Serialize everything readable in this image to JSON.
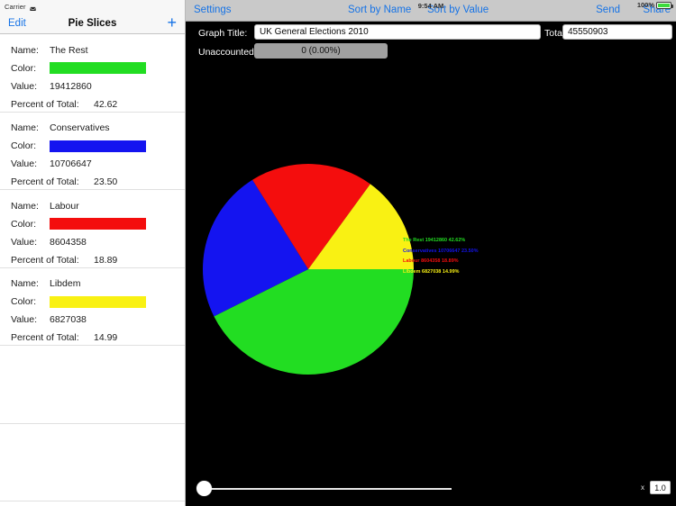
{
  "status": {
    "carrier": "Carrier",
    "wifi_icon": "wifi-icon",
    "clock": "9:54 AM",
    "battery_percent": "100%"
  },
  "left_panel": {
    "edit_label": "Edit",
    "title": "Pie Slices",
    "add_label": "+",
    "field_labels": {
      "name": "Name:",
      "color": "Color:",
      "value": "Value:",
      "percent": "Percent of Total:"
    },
    "slices": [
      {
        "name": "The Rest",
        "color": "#22dd22",
        "value": "19412860",
        "percent": "42.62"
      },
      {
        "name": "Conservatives",
        "color": "#1414f0",
        "value": "10706647",
        "percent": "23.50"
      },
      {
        "name": "Labour",
        "color": "#f40d0d",
        "value": "8604358",
        "percent": "18.89"
      },
      {
        "name": "Libdem",
        "color": "#f9f113",
        "value": "6827038",
        "percent": "14.99"
      }
    ]
  },
  "toolbar": {
    "settings": "Settings",
    "sort_by_name": "Sort by Name",
    "sort_by_value": "Sort by Value",
    "send": "Send",
    "share": "Share"
  },
  "form": {
    "graph_title_label": "Graph Title:",
    "graph_title_value": "UK General Elections 2010",
    "graph_title_placeholder": "Graph Title",
    "total_label": "Total:",
    "total_value": "45550903",
    "total_placeholder": "Total",
    "unaccounted_label": "Unaccounted:",
    "unaccounted_value": "0 (0.00%)"
  },
  "slider": {
    "x_label": "x",
    "value": "1.0",
    "position_percent": 0
  },
  "chart_data": {
    "type": "pie",
    "title": "UK General Elections 2010",
    "total": 45550903,
    "center": [
      335,
      302
    ],
    "radius": 117,
    "start_angle_deg": 0,
    "direction": "clockwise",
    "legend_position": "right",
    "categories": [
      "The Rest",
      "Conservatives",
      "Labour",
      "Libdem"
    ],
    "values": [
      19412860,
      10706647,
      8604358,
      6827038
    ],
    "percents": [
      42.62,
      23.5,
      18.89,
      14.99
    ],
    "colors": [
      "#22dd22",
      "#1414f0",
      "#f40d0d",
      "#f9f113"
    ],
    "legend_labels": [
      "The Rest 19412860 42.62%",
      "Conservatives 10706647 23.50%",
      "Labour 8604358 18.89%",
      "Libdem 6827038 14.99%"
    ]
  }
}
